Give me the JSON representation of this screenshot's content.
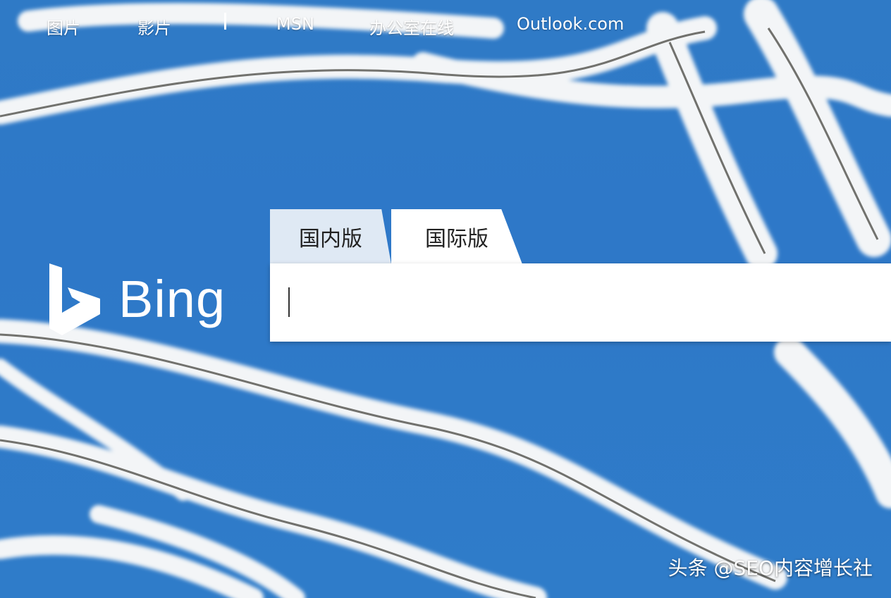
{
  "nav": {
    "images": "图片",
    "videos": "影片",
    "msn": "MSN",
    "office": "办公室在线",
    "outlook": "Outlook.com"
  },
  "logo": {
    "text": "Bing"
  },
  "tabs": {
    "domestic": "国内版",
    "international": "国际版",
    "active": "国际版"
  },
  "search": {
    "value": "",
    "placeholder": ""
  },
  "watermark": "头条 @SEO内容增长社",
  "colors": {
    "sky": "#2f7ac6",
    "tab_inactive": "#dfe9f4",
    "frost": "#f4f6f8"
  }
}
